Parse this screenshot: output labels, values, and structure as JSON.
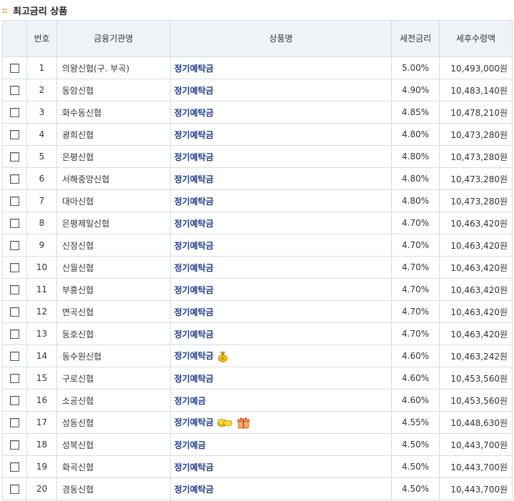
{
  "title": "최고금리 상품",
  "title_bullet": "::",
  "columns": {
    "number": "번호",
    "institution": "금융기관명",
    "product": "상품명",
    "rate": "세전금리",
    "amount": "세후수령액"
  },
  "rows": [
    {
      "no": "1",
      "institution": "의왕신협(구. 부곡)",
      "product": "정기예탁금",
      "rate": "5.00%",
      "amount": "10,493,000원",
      "icons": []
    },
    {
      "no": "2",
      "institution": "동암신협",
      "product": "정기예탁금",
      "rate": "4.90%",
      "amount": "10,483,140원",
      "icons": []
    },
    {
      "no": "3",
      "institution": "화수동신협",
      "product": "정기예탁금",
      "rate": "4.85%",
      "amount": "10,478,210원",
      "icons": []
    },
    {
      "no": "4",
      "institution": "광희신협",
      "product": "정기예탁금",
      "rate": "4.80%",
      "amount": "10,473,280원",
      "icons": []
    },
    {
      "no": "5",
      "institution": "은평신협",
      "product": "정기예탁금",
      "rate": "4.80%",
      "amount": "10,473,280원",
      "icons": []
    },
    {
      "no": "6",
      "institution": "서해중앙신협",
      "product": "정기예탁금",
      "rate": "4.80%",
      "amount": "10,473,280원",
      "icons": []
    },
    {
      "no": "7",
      "institution": "대아신협",
      "product": "정기예탁금",
      "rate": "4.80%",
      "amount": "10,473,280원",
      "icons": []
    },
    {
      "no": "8",
      "institution": "은평제일신협",
      "product": "정기예탁금",
      "rate": "4.70%",
      "amount": "10,463,420원",
      "icons": []
    },
    {
      "no": "9",
      "institution": "신정신협",
      "product": "정기예탁금",
      "rate": "4.70%",
      "amount": "10,463,420원",
      "icons": []
    },
    {
      "no": "10",
      "institution": "신월신협",
      "product": "정기예탁금",
      "rate": "4.70%",
      "amount": "10,463,420원",
      "icons": []
    },
    {
      "no": "11",
      "institution": "부흥신협",
      "product": "정기예탁금",
      "rate": "4.70%",
      "amount": "10,463,420원",
      "icons": []
    },
    {
      "no": "12",
      "institution": "면곡신협",
      "product": "정기예탁금",
      "rate": "4.70%",
      "amount": "10,463,420원",
      "icons": []
    },
    {
      "no": "13",
      "institution": "동호신협",
      "product": "정기예탁금",
      "rate": "4.70%",
      "amount": "10,463,420원",
      "icons": []
    },
    {
      "no": "14",
      "institution": "동수원신협",
      "product": "정기예탁금",
      "rate": "4.60%",
      "amount": "10,463,242원",
      "icons": [
        "money-bag-icon"
      ]
    },
    {
      "no": "15",
      "institution": "구로신협",
      "product": "정기예탁금",
      "rate": "4.60%",
      "amount": "10,453,560원",
      "icons": []
    },
    {
      "no": "16",
      "institution": "소공신협",
      "product": "정기예금",
      "rate": "4.60%",
      "amount": "10,453,560원",
      "icons": []
    },
    {
      "no": "17",
      "institution": "성동신협",
      "product": "정기예탁금",
      "rate": "4.55%",
      "amount": "10,448,630원",
      "icons": [
        "coins-icon",
        "gift-icon"
      ]
    },
    {
      "no": "18",
      "institution": "성북신협",
      "product": "정기예금",
      "rate": "4.50%",
      "amount": "10,443,700원",
      "icons": []
    },
    {
      "no": "19",
      "institution": "화곡신협",
      "product": "정기예탁금",
      "rate": "4.50%",
      "amount": "10,443,700원",
      "icons": []
    },
    {
      "no": "20",
      "institution": "경동신협",
      "product": "정기예탁금",
      "rate": "4.50%",
      "amount": "10,443,700원",
      "icons": []
    }
  ],
  "colors": {
    "header_bg": "#eef3f8",
    "border": "#d5dde5",
    "link": "#1f3b8c",
    "bullet": "#f08c00"
  }
}
